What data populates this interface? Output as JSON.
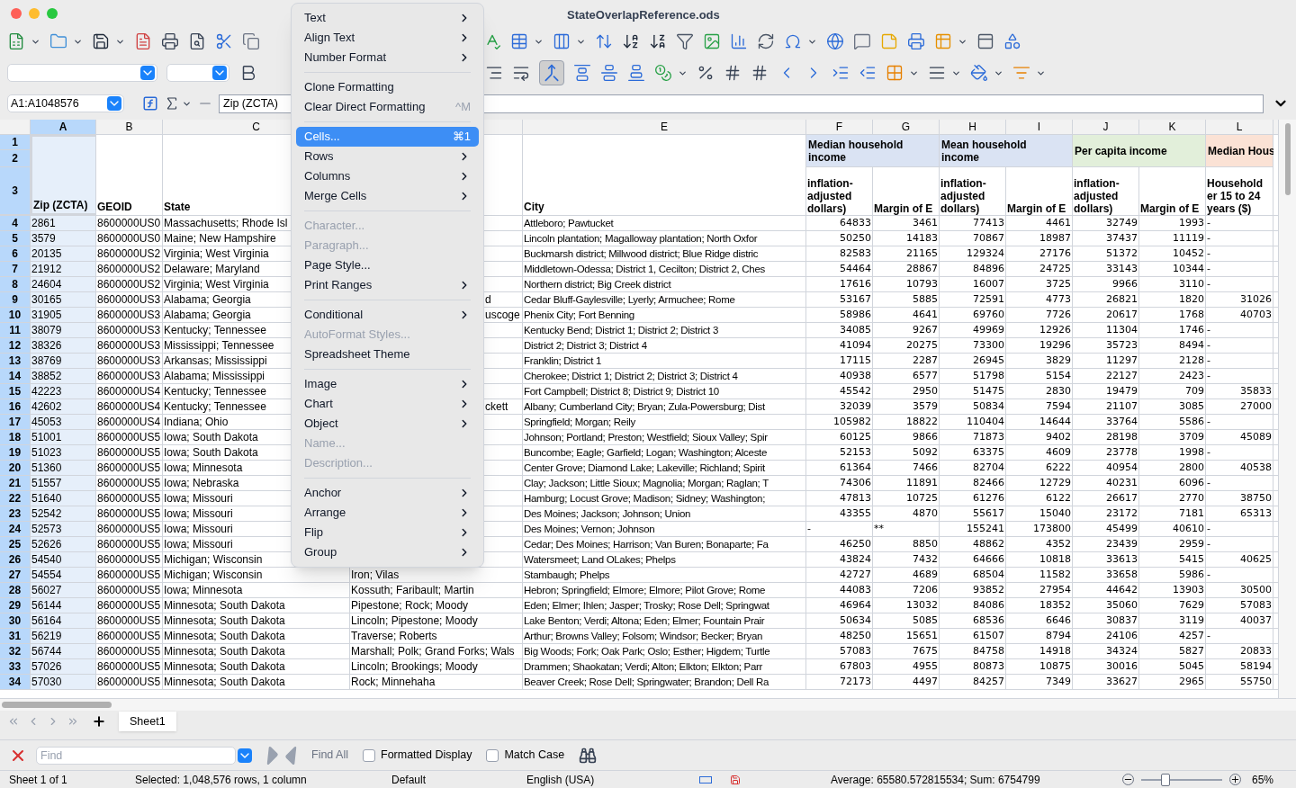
{
  "window": {
    "title": "StateOverlapReference.ods"
  },
  "toolbar": {
    "merge_pressed": true
  },
  "formula_bar": {
    "name_box": "A1:A1048576",
    "content": "Zip (ZCTA)"
  },
  "columns": [
    {
      "letter": "A",
      "selected": true
    },
    {
      "letter": "B",
      "selected": false
    },
    {
      "letter": "C",
      "selected": false
    },
    {
      "selected": false
    },
    {
      "letter": "E",
      "selected": false
    },
    {
      "letter": "F",
      "selected": false
    },
    {
      "letter": "G",
      "selected": false
    },
    {
      "letter": "H",
      "selected": false
    },
    {
      "letter": "I",
      "selected": false
    },
    {
      "letter": "J",
      "selected": false
    },
    {
      "letter": "K",
      "selected": false
    },
    {
      "letter": "L",
      "selected": false
    }
  ],
  "header_row_numbers": [
    "1",
    "2",
    "3"
  ],
  "field_headers": {
    "zip": "Zip (ZCTA)",
    "geoid": "GEOID",
    "state": "State",
    "city": "City"
  },
  "group_headers": [
    {
      "label": "Median household income",
      "color": "#dae3f3",
      "fields": [
        "inflation-\nadjusted\ndollars)",
        "Margin of E"
      ]
    },
    {
      "label": "Mean household income",
      "color": "#dae3f3",
      "fields": [
        "inflation-\nadjusted\ndollars)",
        "Margin of E"
      ]
    },
    {
      "label": "Per capita income",
      "color": "#e2efda",
      "fields": [
        "inflation-\nadjusted\ndollars)",
        "Margin of E"
      ]
    },
    {
      "label": "Median Hous",
      "color": "#fbe2d5",
      "fields": [
        "Household\ner 15 to 24\nyears ($)"
      ]
    }
  ],
  "rows": [
    {
      "n": "4",
      "zip": "2861",
      "geoid": "8600000US0",
      "state": "Massachusetts; Rhode Isl",
      "city": "Attleboro; Pawtucket",
      "values": [
        "64833",
        "3461",
        "77413",
        "4461",
        "32749",
        "1993",
        "-"
      ]
    },
    {
      "n": "5",
      "zip": "3579",
      "geoid": "8600000US0",
      "state": "Maine; New Hampshire",
      "city": "Lincoln plantation; Magalloway plantation; North Oxfor",
      "values": [
        "50250",
        "14183",
        "70867",
        "18987",
        "37437",
        "11119",
        "-"
      ]
    },
    {
      "n": "6",
      "zip": "20135",
      "geoid": "8600000US2",
      "state": "Virginia; West Virginia",
      "city": "Buckmarsh district; Millwood district; Blue Ridge distric",
      "values": [
        "82583",
        "21165",
        "129324",
        "27176",
        "51372",
        "10452",
        "-"
      ]
    },
    {
      "n": "7",
      "zip": "21912",
      "geoid": "8600000US2",
      "state": "Delaware; Maryland",
      "city": "Middletown-Odessa; District 1, Cecilton; District 2, Ches",
      "values": [
        "54464",
        "28867",
        "84896",
        "24725",
        "33143",
        "10344",
        "-"
      ]
    },
    {
      "n": "8",
      "zip": "24604",
      "geoid": "8600000US2",
      "state": "Virginia; West Virginia",
      "city": "Northern district; Big Creek district",
      "values": [
        "17616",
        "10793",
        "16007",
        "3725",
        "9966",
        "3110",
        "-"
      ]
    },
    {
      "n": "9",
      "zip": "30165",
      "geoid": "8600000US3",
      "state": "Alabama; Georgia",
      "county": "d",
      "county_cut": true,
      "city": "Cedar Bluff-Gaylesville; Lyerly; Armuchee; Rome",
      "values": [
        "53167",
        "5885",
        "72591",
        "4773",
        "26821",
        "1820",
        "31026"
      ]
    },
    {
      "n": "10",
      "zip": "31905",
      "geoid": "8600000US3",
      "state": "Alabama; Georgia",
      "county": "uscoge",
      "county_cut": true,
      "city": "Phenix City; Fort Benning",
      "values": [
        "58986",
        "4641",
        "69760",
        "7726",
        "20617",
        "1768",
        "40703"
      ]
    },
    {
      "n": "11",
      "zip": "38079",
      "geoid": "8600000US3",
      "state": "Kentucky; Tennessee",
      "city": "Kentucky Bend; District 1; District 2; District 3",
      "values": [
        "34085",
        "9267",
        "49969",
        "12926",
        "11304",
        "1746",
        "-"
      ]
    },
    {
      "n": "12",
      "zip": "38326",
      "geoid": "8600000US3",
      "state": "Mississippi; Tennessee",
      "city": "District 2; District 3; District 4",
      "values": [
        "41094",
        "20275",
        "73300",
        "19296",
        "35723",
        "8494",
        "-"
      ]
    },
    {
      "n": "13",
      "zip": "38769",
      "geoid": "8600000US3",
      "state": "Arkansas; Mississippi",
      "city": "Franklin; District 1",
      "values": [
        "17115",
        "2287",
        "26945",
        "3829",
        "11297",
        "2128",
        "-"
      ]
    },
    {
      "n": "14",
      "zip": "38852",
      "geoid": "8600000US3",
      "state": "Alabama; Mississippi",
      "city": "Cherokee; District 1; District 2; District 3; District 4",
      "values": [
        "40938",
        "6577",
        "51798",
        "5154",
        "22127",
        "2423",
        "-"
      ]
    },
    {
      "n": "15",
      "zip": "42223",
      "geoid": "8600000US4",
      "state": "Kentucky; Tennessee",
      "city": "Fort Campbell; District 8; District 9; District 10",
      "values": [
        "45542",
        "2950",
        "51475",
        "2830",
        "19479",
        "709",
        "35833"
      ]
    },
    {
      "n": "16",
      "zip": "42602",
      "geoid": "8600000US4",
      "state": "Kentucky; Tennessee",
      "county": "ckett",
      "county_cut": true,
      "city": "Albany; Cumberland City; Bryan; Zula-Powersburg; Dist",
      "values": [
        "32039",
        "3579",
        "50834",
        "7594",
        "21107",
        "3085",
        "27000"
      ]
    },
    {
      "n": "17",
      "zip": "45053",
      "geoid": "8600000US4",
      "state": "Indiana; Ohio",
      "city": "Springfield; Morgan; Reily",
      "values": [
        "105982",
        "18822",
        "110404",
        "14644",
        "33764",
        "5586",
        "-"
      ]
    },
    {
      "n": "18",
      "zip": "51001",
      "geoid": "8600000US5",
      "state": "Iowa; South Dakota",
      "city": "Johnson; Portland; Preston; Westfield; Sioux Valley; Spir",
      "values": [
        "60125",
        "9866",
        "71873",
        "9402",
        "28198",
        "3709",
        "45089"
      ]
    },
    {
      "n": "19",
      "zip": "51023",
      "geoid": "8600000US5",
      "state": "Iowa; South Dakota",
      "city": "Buncombe; Eagle; Garfield; Logan; Washington; Alceste",
      "values": [
        "52153",
        "5092",
        "63375",
        "4609",
        "23778",
        "1998",
        "-"
      ]
    },
    {
      "n": "20",
      "zip": "51360",
      "geoid": "8600000US5",
      "state": "Iowa; Minnesota",
      "city": "Center Grove; Diamond Lake; Lakeville; Richland; Spirit",
      "values": [
        "61364",
        "7466",
        "82704",
        "6222",
        "40954",
        "2800",
        "40538"
      ]
    },
    {
      "n": "21",
      "zip": "51557",
      "geoid": "8600000US5",
      "state": "Iowa; Nebraska",
      "city": "Clay; Jackson; Little Sioux; Magnolia; Morgan; Raglan; T",
      "values": [
        "74306",
        "11891",
        "82466",
        "12729",
        "40231",
        "6096",
        "-"
      ]
    },
    {
      "n": "22",
      "zip": "51640",
      "geoid": "8600000US5",
      "state": "Iowa; Missouri",
      "city": "Hamburg; Locust Grove; Madison; Sidney; Washington;",
      "values": [
        "47813",
        "10725",
        "61276",
        "6122",
        "26617",
        "2770",
        "38750"
      ]
    },
    {
      "n": "23",
      "zip": "52542",
      "geoid": "8600000US5",
      "state": "Iowa; Missouri",
      "city": "Des Moines; Jackson; Johnson; Union",
      "values": [
        "43355",
        "4870",
        "55617",
        "15040",
        "23172",
        "7181",
        "65313"
      ]
    },
    {
      "n": "24",
      "zip": "52573",
      "geoid": "8600000US5",
      "state": "Iowa; Missouri",
      "city": "Des Moines; Vernon; Johnson",
      "values": [
        "-",
        "**",
        "155241",
        "173800",
        "45499",
        "40610",
        "-"
      ]
    },
    {
      "n": "25",
      "zip": "52626",
      "geoid": "8600000US5",
      "state": "Iowa; Missouri",
      "city": "Cedar; Des Moines; Harrison; Van Buren; Bonaparte; Fa",
      "values": [
        "46250",
        "8850",
        "48862",
        "4352",
        "23439",
        "2959",
        "-"
      ]
    },
    {
      "n": "26",
      "zip": "54540",
      "geoid": "8600000US5",
      "state": "Michigan; Wisconsin",
      "city": "Watersmeet; Land OLakes; Phelps",
      "values": [
        "43824",
        "7432",
        "64666",
        "10818",
        "33613",
        "5415",
        "40625"
      ]
    },
    {
      "n": "27",
      "zip": "54554",
      "geoid": "8600000US5",
      "state": "Michigan; Wisconsin",
      "county": "Iron; Vilas",
      "county_cut": false,
      "city": "Stambaugh; Phelps",
      "values": [
        "42727",
        "4689",
        "68504",
        "11582",
        "33658",
        "5986",
        "-"
      ]
    },
    {
      "n": "28",
      "zip": "56027",
      "geoid": "8600000US5",
      "state": "Iowa; Minnesota",
      "county": "Kossuth; Faribault; Martin",
      "county_cut": false,
      "city": "Hebron; Springfield; Elmore; Elmore; Pilot Grove; Rome",
      "values": [
        "44083",
        "7206",
        "93852",
        "27954",
        "44642",
        "13903",
        "30500"
      ]
    },
    {
      "n": "29",
      "zip": "56144",
      "geoid": "8600000US5",
      "state": "Minnesota; South Dakota",
      "county": "Pipestone; Rock; Moody",
      "county_cut": false,
      "city": "Eden; Elmer; Ihlen; Jasper; Trosky; Rose Dell; Springwat",
      "values": [
        "46964",
        "13032",
        "84086",
        "18352",
        "35060",
        "7629",
        "57083"
      ]
    },
    {
      "n": "30",
      "zip": "56164",
      "geoid": "8600000US5",
      "state": "Minnesota; South Dakota",
      "county": "Lincoln; Pipestone; Moody",
      "county_cut": false,
      "city": "Lake Benton; Verdi; Altona; Eden; Elmer; Fountain Prair",
      "values": [
        "50634",
        "5085",
        "68536",
        "6646",
        "30837",
        "3119",
        "40037"
      ]
    },
    {
      "n": "31",
      "zip": "56219",
      "geoid": "8600000US5",
      "state": "Minnesota; South Dakota",
      "county": "Traverse; Roberts",
      "county_cut": false,
      "city": "Arthur; Browns Valley; Folsom; Windsor; Becker; Bryan",
      "values": [
        "48250",
        "15651",
        "61507",
        "8794",
        "24106",
        "4257",
        "-"
      ]
    },
    {
      "n": "32",
      "zip": "56744",
      "geoid": "8600000US5",
      "state": "Minnesota; South Dakota",
      "county": "Marshall; Polk; Grand Forks; Wals",
      "county_cut": false,
      "city": "Big Woods; Fork; Oak Park; Oslo; Esther; Higdem; Turtle",
      "values": [
        "57083",
        "7675",
        "84758",
        "14918",
        "34324",
        "5827",
        "20833"
      ]
    },
    {
      "n": "33",
      "zip": "57026",
      "geoid": "8600000US5",
      "state": "Minnesota; South Dakota",
      "county": "Lincoln; Brookings; Moody",
      "county_cut": false,
      "city": "Drammen; Shaokatan; Verdi; Alton; Elkton; Elkton; Parr",
      "values": [
        "67803",
        "4955",
        "80873",
        "10875",
        "30016",
        "5045",
        "58194"
      ]
    },
    {
      "n": "34",
      "zip": "57030",
      "geoid": "8600000US5",
      "state": "Minnesota; South Dakota",
      "county": "Rock; Minnehaha",
      "county_cut": false,
      "city": "Beaver Creek; Rose Dell; Springwater; Brandon; Dell Ra",
      "values": [
        "72173",
        "4497",
        "84257",
        "7349",
        "33627",
        "2965",
        "55750"
      ]
    }
  ],
  "context_menu": [
    {
      "kind": "item",
      "label": "Text",
      "submenu": true,
      "disabled": false,
      "selected": false
    },
    {
      "kind": "item",
      "label": "Align Text",
      "submenu": true,
      "disabled": false,
      "selected": false
    },
    {
      "kind": "item",
      "label": "Number Format",
      "submenu": true,
      "disabled": false,
      "selected": false
    },
    {
      "kind": "separator"
    },
    {
      "kind": "item",
      "label": "Clone Formatting",
      "submenu": false,
      "disabled": false,
      "selected": false
    },
    {
      "kind": "item",
      "label": "Clear Direct Formatting",
      "shortcut": "^M",
      "submenu": false,
      "disabled": false,
      "selected": false
    },
    {
      "kind": "separator"
    },
    {
      "kind": "item",
      "label": "Cells...",
      "shortcut": "⌘1",
      "submenu": false,
      "disabled": false,
      "selected": true
    },
    {
      "kind": "item",
      "label": "Rows",
      "submenu": true,
      "disabled": false,
      "selected": false
    },
    {
      "kind": "item",
      "label": "Columns",
      "submenu": true,
      "disabled": false,
      "selected": false
    },
    {
      "kind": "item",
      "label": "Merge Cells",
      "submenu": true,
      "disabled": false,
      "selected": false
    },
    {
      "kind": "separator"
    },
    {
      "kind": "item",
      "label": "Character...",
      "submenu": false,
      "disabled": true,
      "selected": false
    },
    {
      "kind": "item",
      "label": "Paragraph...",
      "submenu": false,
      "disabled": true,
      "selected": false
    },
    {
      "kind": "item",
      "label": "Page Style...",
      "submenu": false,
      "disabled": false,
      "selected": false
    },
    {
      "kind": "item",
      "label": "Print Ranges",
      "submenu": true,
      "disabled": false,
      "selected": false
    },
    {
      "kind": "separator"
    },
    {
      "kind": "item",
      "label": "Conditional",
      "submenu": true,
      "disabled": false,
      "selected": false
    },
    {
      "kind": "item",
      "label": "AutoFormat Styles...",
      "submenu": false,
      "disabled": true,
      "selected": false
    },
    {
      "kind": "item",
      "label": "Spreadsheet Theme",
      "submenu": false,
      "disabled": false,
      "selected": false
    },
    {
      "kind": "separator"
    },
    {
      "kind": "item",
      "label": "Image",
      "submenu": true,
      "disabled": false,
      "selected": false
    },
    {
      "kind": "item",
      "label": "Chart",
      "submenu": true,
      "disabled": false,
      "selected": false
    },
    {
      "kind": "item",
      "label": "Object",
      "submenu": true,
      "disabled": false,
      "selected": false
    },
    {
      "kind": "item",
      "label": "Name...",
      "submenu": false,
      "disabled": true,
      "selected": false
    },
    {
      "kind": "item",
      "label": "Description...",
      "submenu": false,
      "disabled": true,
      "selected": false
    },
    {
      "kind": "separator"
    },
    {
      "kind": "item",
      "label": "Anchor",
      "submenu": true,
      "disabled": false,
      "selected": false
    },
    {
      "kind": "item",
      "label": "Arrange",
      "submenu": true,
      "disabled": false,
      "selected": false
    },
    {
      "kind": "item",
      "label": "Flip",
      "submenu": true,
      "disabled": false,
      "selected": false
    },
    {
      "kind": "item",
      "label": "Group",
      "submenu": true,
      "disabled": false,
      "selected": false
    }
  ],
  "sheet_tabs": [
    {
      "label": "Sheet1",
      "selected": true
    }
  ],
  "find_bar": {
    "placeholder": "Find",
    "find_all": "Find All",
    "options": [
      {
        "label": "Formatted Display",
        "checked": false
      },
      {
        "label": "Match Case",
        "checked": false
      }
    ]
  },
  "status_bar": {
    "sheet": "Sheet 1 of 1",
    "selection": "Selected: 1,048,576 rows, 1 column",
    "page_style": "Default",
    "language": "English (USA)",
    "summary": "Average: 65580.572815534; Sum: 6754799",
    "zoom": {
      "level": 0.3,
      "reading": "65%"
    }
  }
}
